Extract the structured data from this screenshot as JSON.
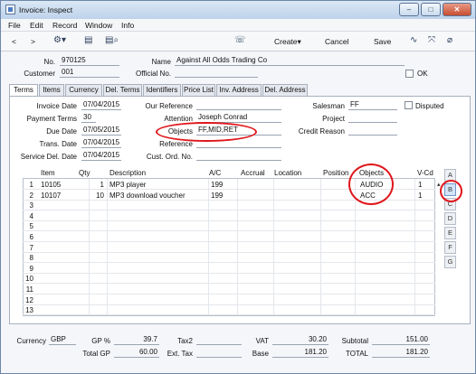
{
  "window": {
    "title": "Invoice: Inspect",
    "min": "–",
    "max": "□",
    "close": "✕"
  },
  "menu": [
    "File",
    "Edit",
    "Record",
    "Window",
    "Info"
  ],
  "toolbar": {
    "back": "<",
    "forward": ">",
    "create": "Create▾",
    "cancel": "Cancel",
    "save": "Save"
  },
  "header": {
    "no_label": "No.",
    "no_value": "970125",
    "name_label": "Name",
    "name_value": "Against All Odds Trading Co",
    "customer_label": "Customer",
    "customer_value": "001",
    "official_label": "Official No.",
    "official_value": "",
    "ok_label": "OK"
  },
  "tabs": [
    "Terms",
    "Items",
    "Currency",
    "Del. Terms",
    "Identifiers",
    "Price List",
    "Inv. Address",
    "Del. Address"
  ],
  "terms": {
    "invoice_date_label": "Invoice Date",
    "invoice_date": "07/04/2015",
    "payment_terms_label": "Payment Terms",
    "payment_terms": "30",
    "due_date_label": "Due Date",
    "due_date": "07/05/2015",
    "trans_date_label": "Trans. Date",
    "trans_date": "07/04/2015",
    "service_del_label": "Service Del. Date",
    "service_del": "07/04/2015",
    "our_ref_label": "Our Reference",
    "our_ref": "",
    "attention_label": "Attention",
    "attention": "Joseph Conrad",
    "objects_label": "Objects",
    "objects": "FF,MID,RET",
    "reference_label": "Reference",
    "reference": "",
    "cust_ord_label": "Cust. Ord. No.",
    "cust_ord": "",
    "salesman_label": "Salesman",
    "salesman": "FF",
    "disputed_label": "Disputed",
    "project_label": "Project",
    "project": "",
    "credit_reason_label": "Credit Reason",
    "credit_reason": ""
  },
  "grid": {
    "headers": [
      "Item",
      "Qty",
      "Description",
      "A/C",
      "Accrual",
      "Location",
      "Position",
      "Objects",
      "V-Cd"
    ],
    "rows": [
      {
        "n": "1",
        "item": "10105",
        "qty": "1",
        "desc": "MP3 player",
        "ac": "199",
        "objects": "AUDIO",
        "vcd": "1"
      },
      {
        "n": "2",
        "item": "10107",
        "qty": "10",
        "desc": "MP3 download voucher",
        "ac": "199",
        "objects": "ACC",
        "vcd": "1"
      },
      {
        "n": "3"
      },
      {
        "n": "4"
      },
      {
        "n": "5"
      },
      {
        "n": "6"
      },
      {
        "n": "7"
      },
      {
        "n": "8"
      },
      {
        "n": "9"
      },
      {
        "n": "10"
      },
      {
        "n": "11"
      },
      {
        "n": "12"
      },
      {
        "n": "13"
      }
    ],
    "side_buttons": [
      "A",
      "B",
      "C",
      "D",
      "E",
      "F",
      "G"
    ]
  },
  "footer": {
    "currency_label": "Currency",
    "currency": "GBP",
    "gp_pct_label": "GP %",
    "gp_pct": "39.7",
    "total_gp_label": "Total GP",
    "total_gp": "60.00",
    "tax2_label": "Tax2",
    "tax2": "",
    "ext_tax_label": "Ext. Tax",
    "ext_tax": "",
    "vat_label": "VAT",
    "vat": "30.20",
    "base_label": "Base",
    "base": "181.20",
    "subtotal_label": "Subtotal",
    "subtotal": "151.00",
    "total_label": "TOTAL",
    "total": "181.20"
  },
  "colors": {
    "annotation": "#e0161b",
    "accent": "#4a7bc7"
  }
}
